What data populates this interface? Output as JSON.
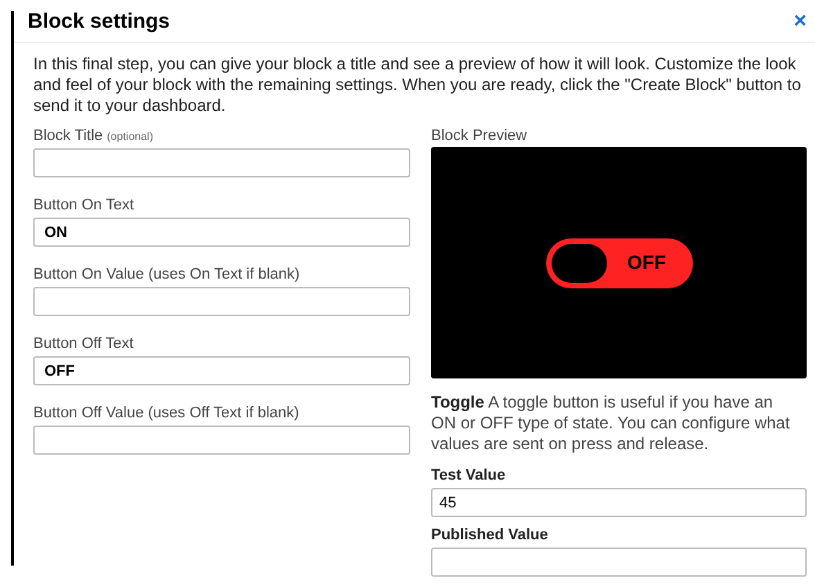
{
  "dialog": {
    "title": "Block settings",
    "close": "×"
  },
  "intro": "In this final step, you can give your block a title and see a preview of how it will look. Customize the look and feel of your block with the remaining settings. When you are ready, click the \"Create Block\" button to send it to your dashboard.",
  "fields": [
    {
      "label": "Block Title",
      "note": "(optional)"
    },
    {
      "label": "Button On Text",
      "value": "ON"
    },
    {
      "label": "Button On Value (uses On Text if blank)"
    },
    {
      "label": "Button Off Text",
      "value": "OFF"
    },
    {
      "label": "Button Off Value (uses Off Text if blank)"
    }
  ],
  "preview": {
    "label": "Block Preview",
    "toggle": {
      "on": false,
      "text": "OFF"
    }
  },
  "description": "**Toggle** A toggle button is useful if you have an ON or OFF type of state. You can configure what values are sent on press and release.",
  "test_fields": [
    {
      "label": "Test Value",
      "value": "45"
    },
    {
      "label": "Published Value"
    }
  ]
}
